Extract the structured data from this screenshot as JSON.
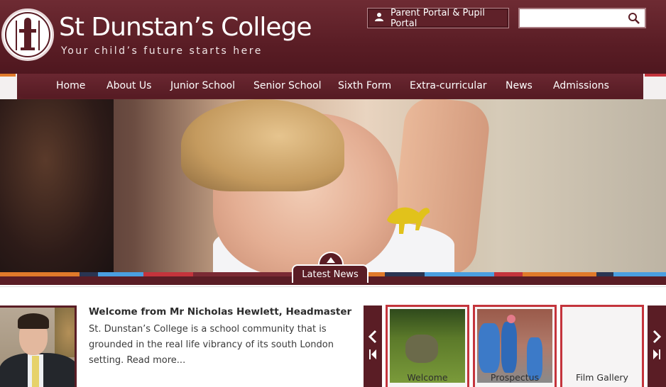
{
  "brand": {
    "title": "St Dunstan’s College",
    "tagline": "Your child’s future starts here"
  },
  "header": {
    "portal_label": "Parent Portal & Pupil Portal",
    "search_placeholder": ""
  },
  "nav": {
    "items": [
      {
        "label": "Home"
      },
      {
        "label": "About Us"
      },
      {
        "label": "Junior School"
      },
      {
        "label": "Senior School"
      },
      {
        "label": "Sixth Form"
      },
      {
        "label": "Extra-curricular"
      },
      {
        "label": "News"
      },
      {
        "label": "Admissions"
      }
    ]
  },
  "hero": {
    "latest_news_label": "Latest News"
  },
  "welcome": {
    "title": "Welcome from Mr Nicholas Hewlett, Headmaster",
    "body": "St. Dunstan’s College is a school community that is grounded in the real life vibrancy of its south London setting.  Read more..."
  },
  "carousel": {
    "items": [
      {
        "label": "Welcome"
      },
      {
        "label": "Prospectus"
      },
      {
        "label": "Film Gallery"
      }
    ]
  },
  "colors": {
    "brand_maroon": "#5a1d25",
    "thumb_border": "#c4343c",
    "stripe": [
      "#e07a2a",
      "#2a3552",
      "#4a9fe0",
      "#c4343c",
      "#7a2a34",
      "#e07a2a",
      "#2a3552",
      "#4a9fe0",
      "#c4343c",
      "#e07a2a",
      "#2a3552",
      "#4a9fe0"
    ]
  }
}
